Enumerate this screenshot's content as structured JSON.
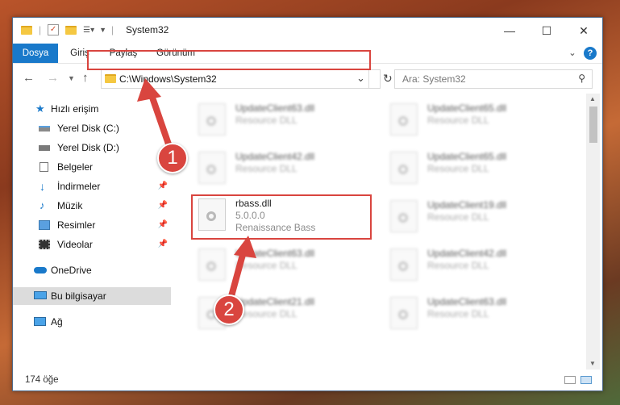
{
  "window": {
    "title": "System32",
    "controls": {
      "minimize": "—",
      "maximize": "☐",
      "close": "✕"
    }
  },
  "ribbon": {
    "tabs": [
      "Dosya",
      "Giriş",
      "Paylaş",
      "Görünüm"
    ],
    "expand": "⌄",
    "help": "?"
  },
  "address": {
    "path": "C:\\Windows\\System32",
    "dropdown": "⌄",
    "refresh": "↻"
  },
  "search": {
    "placeholder": "Ara: System32"
  },
  "sidebar": {
    "items": [
      {
        "label": "Hızlı erişim",
        "icon": "star-icon"
      },
      {
        "label": "Yerel Disk (C:)",
        "icon": "drive-icon"
      },
      {
        "label": "Yerel Disk (D:)",
        "icon": "drive-icon"
      },
      {
        "label": "Belgeler",
        "icon": "documents-icon"
      },
      {
        "label": "İndirmeler",
        "icon": "download-icon"
      },
      {
        "label": "Müzik",
        "icon": "music-icon"
      },
      {
        "label": "Resimler",
        "icon": "pictures-icon"
      },
      {
        "label": "Videolar",
        "icon": "video-icon"
      },
      {
        "label": "OneDrive",
        "icon": "cloud-icon"
      },
      {
        "label": "Bu bilgisayar",
        "icon": "computer-icon"
      },
      {
        "label": "Ağ",
        "icon": "network-icon"
      }
    ]
  },
  "files": [
    {
      "name": "UpdateClient63.dll",
      "desc": "Resource DLL"
    },
    {
      "name": "UpdateClient65.dll",
      "desc": "Resource DLL"
    },
    {
      "name": "UpdateClient42.dll",
      "desc": "Resource DLL"
    },
    {
      "name": "UpdateClient65.dll",
      "desc": "Resource DLL"
    },
    {
      "name": "rbass.dll",
      "desc": "5.0.0.0",
      "extra": "Renaissance Bass"
    },
    {
      "name": "UpdateClient19.dll",
      "desc": "Resource DLL"
    },
    {
      "name": "UpdateClient63.dll",
      "desc": "Resource DLL"
    },
    {
      "name": "UpdateClient42.dll",
      "desc": "Resource DLL"
    },
    {
      "name": "UpdateClient21.dll",
      "desc": "Resource DLL"
    },
    {
      "name": "UpdateClient63.dll",
      "desc": "Resource DLL"
    }
  ],
  "status": {
    "count": "174 öğe"
  },
  "annotations": {
    "step1": "1",
    "step2": "2"
  },
  "colors": {
    "accent": "#1979ca",
    "highlight": "#d9453f"
  }
}
